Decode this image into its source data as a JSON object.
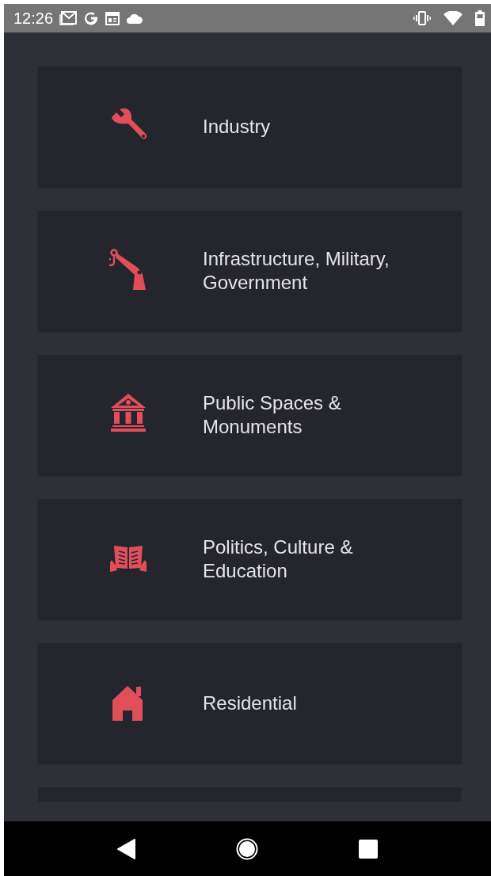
{
  "status_bar": {
    "time": "12:26"
  },
  "categories": [
    {
      "label": "Industry"
    },
    {
      "label": "Infrastructure, Military, Government"
    },
    {
      "label": "Public Spaces & Monuments"
    },
    {
      "label": "Politics, Culture & Education"
    },
    {
      "label": "Residential"
    }
  ]
}
